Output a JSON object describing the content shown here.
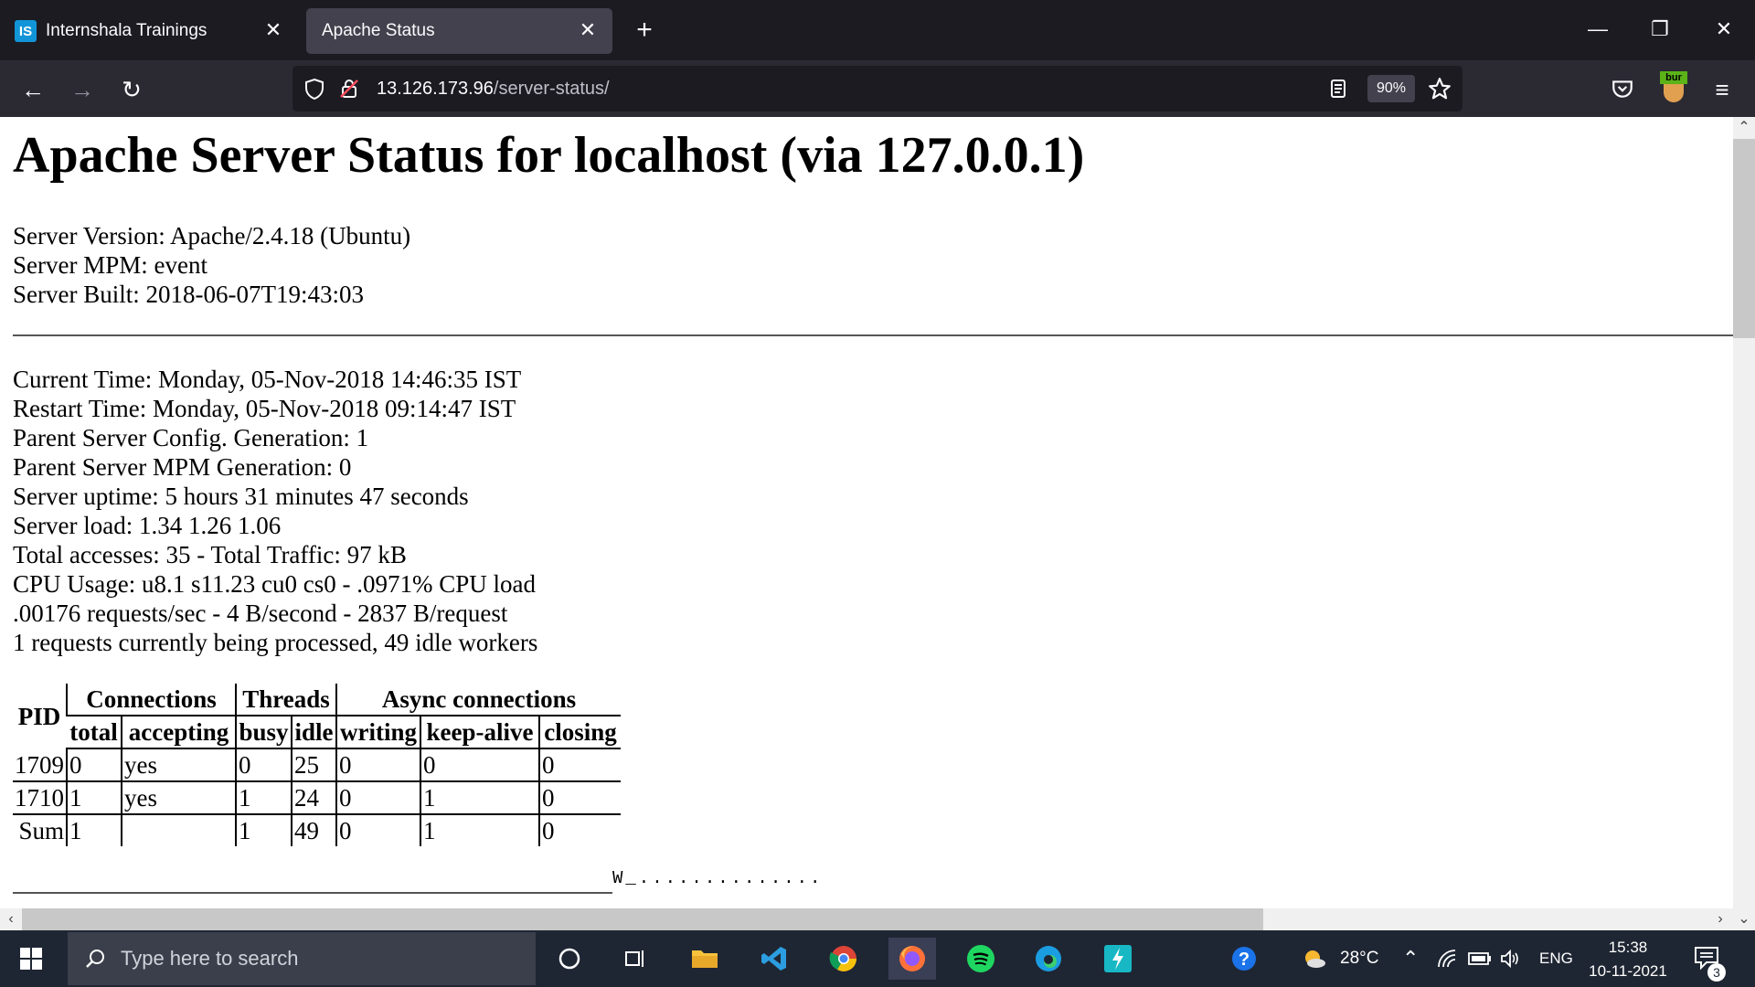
{
  "browser": {
    "tabs": [
      {
        "label": "Internshala Trainings",
        "favicon": "IS"
      },
      {
        "label": "Apache Status"
      }
    ],
    "address": {
      "host": "13.126.173.96",
      "path": "/server-status/"
    },
    "zoom": "90%"
  },
  "page": {
    "title": "Apache Server Status for localhost (via 127.0.0.1)",
    "server_info": [
      "Server Version: Apache/2.4.18 (Ubuntu)",
      "Server MPM: event",
      "Server Built: 2018-06-07T19:43:03"
    ],
    "status_info": [
      "Current Time: Monday, 05-Nov-2018 14:46:35 IST",
      "Restart Time: Monday, 05-Nov-2018 09:14:47 IST",
      "Parent Server Config. Generation: 1",
      "Parent Server MPM Generation: 0",
      "Server uptime: 5 hours 31 minutes 47 seconds",
      "Server load: 1.34 1.26 1.06",
      "Total accesses: 35 - Total Traffic: 97 kB",
      "CPU Usage: u8.1 s11.23 cu0 cs0 - .0971% CPU load",
      ".00176 requests/sec - 4 B/second - 2837 B/request",
      "1 requests currently being processed, 49 idle workers"
    ],
    "table": {
      "group_headers": {
        "pid": "PID",
        "connections": "Connections",
        "threads": "Threads",
        "async": "Async connections"
      },
      "sub_headers": [
        "total",
        "accepting",
        "busy",
        "idle",
        "writing",
        "keep-alive",
        "closing"
      ],
      "rows": [
        [
          "1709",
          "0",
          "yes",
          "0",
          "25",
          "0",
          "0",
          "0"
        ],
        [
          "1710",
          "1",
          "yes",
          "1",
          "24",
          "0",
          "1",
          "0"
        ],
        [
          "Sum",
          "1",
          "",
          "1",
          "49",
          "0",
          "1",
          "0"
        ]
      ]
    },
    "scoreboard": "W_.............."
  },
  "taskbar": {
    "search_placeholder": "Type here to search",
    "temperature": "28°C",
    "language": "ENG",
    "time": "15:38",
    "date": "10-11-2021",
    "notifications": "3"
  },
  "colors": {
    "tabbar": "#1c1b22",
    "navbar": "#2b2a33",
    "taskbar": "#1f2633"
  }
}
